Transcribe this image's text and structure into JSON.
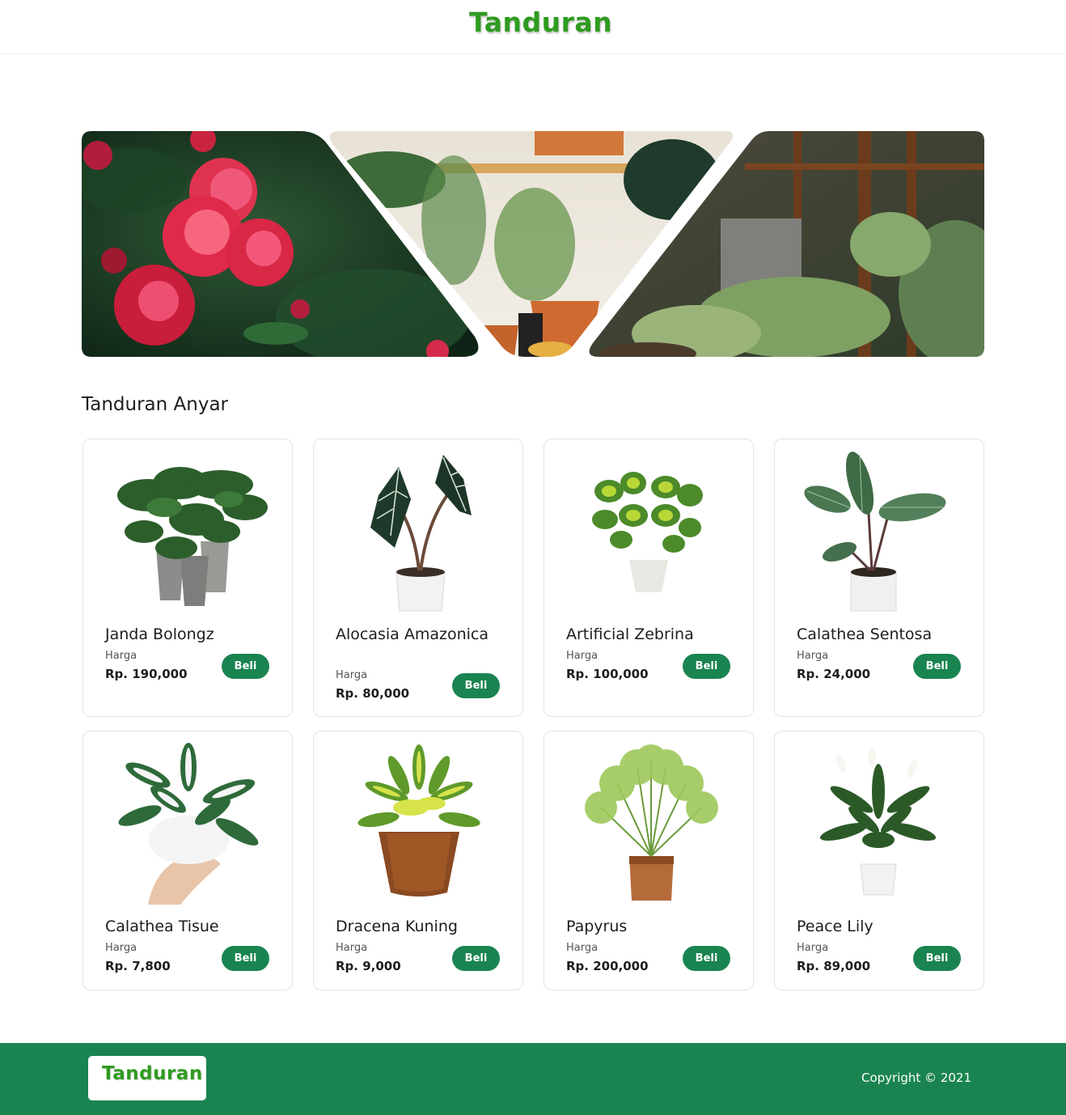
{
  "brand": {
    "name": "Tanduran",
    "color": "#2e9b1f",
    "accent": "#1a8450"
  },
  "section": {
    "title": "Tanduran Anyar"
  },
  "products": [
    {
      "name": "Janda Bolongz",
      "harga_label": "Harga",
      "price": "Rp. 190,000",
      "button": "Beli",
      "image": "monstera-plant-image"
    },
    {
      "name": "Alocasia Amazonica",
      "harga_label": "Harga",
      "price": "Rp. 80,000",
      "button": "Beli",
      "image": "alocasia-plant-image"
    },
    {
      "name": "Artificial Zebrina",
      "harga_label": "Harga",
      "price": "Rp. 100,000",
      "button": "Beli",
      "image": "zebrina-plant-image"
    },
    {
      "name": "Calathea Sentosa",
      "harga_label": "Harga",
      "price": "Rp. 24,000",
      "button": "Beli",
      "image": "calathea-plant-image"
    },
    {
      "name": "Calathea Tisue",
      "harga_label": "Harga",
      "price": "Rp. 7,800",
      "button": "Beli",
      "image": "calathea-tisue-image"
    },
    {
      "name": "Dracena Kuning",
      "harga_label": "Harga",
      "price": "Rp. 9,000",
      "button": "Beli",
      "image": "dracena-plant-image"
    },
    {
      "name": "Papyrus",
      "harga_label": "Harga",
      "price": "Rp. 200,000",
      "button": "Beli",
      "image": "papyrus-plant-image"
    },
    {
      "name": "Peace Lily",
      "harga_label": "Harga",
      "price": "Rp. 89,000",
      "button": "Beli",
      "image": "peace-lily-image"
    }
  ],
  "footer": {
    "copyright": "Copyright © 2021"
  }
}
